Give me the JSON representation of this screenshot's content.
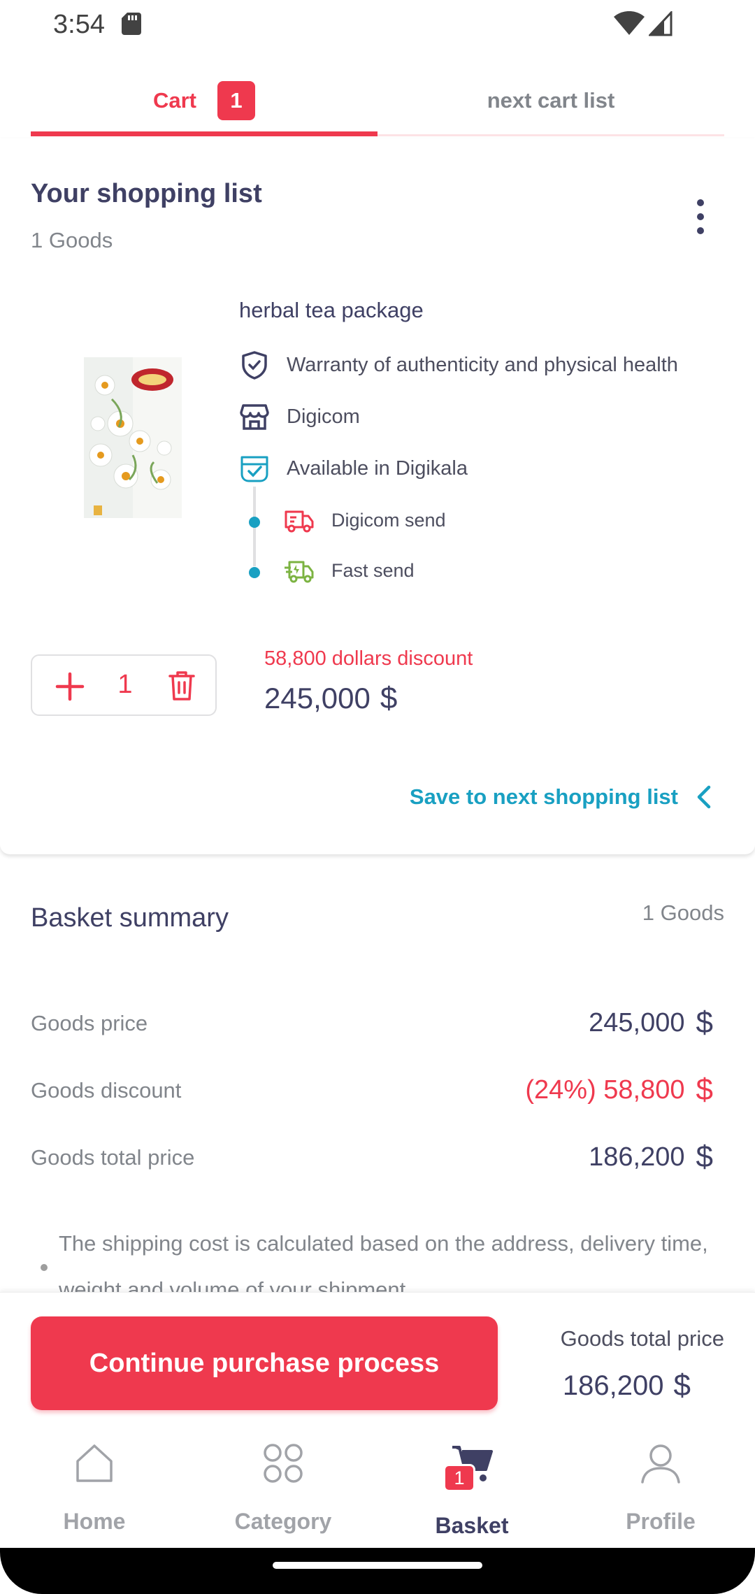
{
  "status": {
    "time": "3:54"
  },
  "tabs": [
    {
      "label": "Cart",
      "badge": "1"
    },
    {
      "label": "next cart list"
    }
  ],
  "cart": {
    "title": "Your shopping list",
    "count": "1 Goods",
    "product": {
      "name": "herbal tea package",
      "features": [
        {
          "icon": "shield-check-icon",
          "text": "Warranty of authenticity and physical health"
        },
        {
          "icon": "store-icon",
          "text": "Digicom"
        },
        {
          "icon": "warehouse-check-icon",
          "text": "Available in Digikala"
        }
      ],
      "shipping": [
        {
          "icon": "truck-icon",
          "text": "Digicom send"
        },
        {
          "icon": "fast-truck-icon",
          "text": "Fast send"
        }
      ],
      "quantity": "1",
      "discount_text": "58,800 dollars discount",
      "price": "245,000",
      "currency_symbol": "$"
    },
    "save_next_label": "Save to next shopping list"
  },
  "summary": {
    "title": "Basket summary",
    "count": "1 Goods",
    "rows": [
      {
        "label": "Goods price",
        "value": "245,000"
      },
      {
        "label": "Goods discount",
        "value": "(24%) 58,800"
      },
      {
        "label": "Goods total price",
        "value": "186,200"
      }
    ],
    "note": "The shipping cost is calculated based on the address, delivery time, weight and volume of your shipment"
  },
  "bottom_bar": {
    "button_label": "Continue purchase process",
    "total_label": "Goods total price",
    "total_value": "186,200"
  },
  "nav": [
    {
      "label": "Home",
      "icon": "home-icon"
    },
    {
      "label": "Category",
      "icon": "category-icon"
    },
    {
      "label": "Basket",
      "icon": "cart-icon",
      "badge": "1"
    },
    {
      "label": "Profile",
      "icon": "profile-icon"
    }
  ],
  "colors": {
    "accent": "#ef394e",
    "link": "#19a0c2",
    "text": "#3f4064",
    "muted": "#81858b"
  }
}
